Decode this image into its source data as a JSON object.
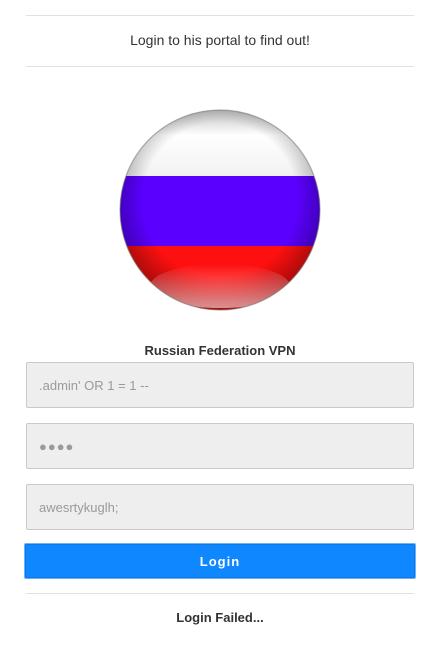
{
  "intro_text": "Login to his portal to find out!",
  "logo": {
    "icon": "russian-flag-sphere-icon",
    "colors": {
      "white": "#ffffff",
      "blue": "#5a00ff",
      "red": "#ff1010"
    }
  },
  "service_title": "Russian Federation VPN",
  "form": {
    "username_placeholder": ".admin' OR 1 = 1 --",
    "password_value": "●●●●",
    "third_field_placeholder": "awesrtykuglh;",
    "login_label": "Login"
  },
  "status_text": "Login Failed...",
  "colors": {
    "button": "#0f87ff",
    "field_bg": "#eeeeee"
  }
}
